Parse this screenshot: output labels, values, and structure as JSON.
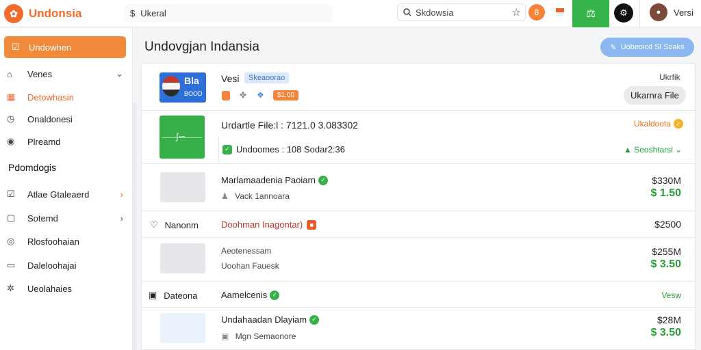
{
  "app": {
    "name": "Undonsia",
    "logo_glyph": "✿"
  },
  "topbar": {
    "search_left": "Ukeral",
    "search_right": "Skdowsia",
    "orange_dot": "8",
    "user_name": "Versi"
  },
  "sidebar": {
    "active_item": "Undowhen",
    "items": [
      {
        "label": "Venes"
      },
      {
        "label": "Detowhasin"
      },
      {
        "label": "Onaldonesi"
      },
      {
        "label": "Plreamd"
      }
    ],
    "section_heading": "Pdomdogis",
    "section_items": [
      {
        "label": "Atlae Gtaleaerd"
      },
      {
        "label": "Sotemd"
      },
      {
        "label": "Rlosfoohaian"
      },
      {
        "label": "Daleloohajai"
      },
      {
        "label": "Ueolahaies"
      }
    ]
  },
  "main": {
    "title": "Undovgjan Indansia",
    "primary_button": "Uobeoicd Sl Soaks"
  },
  "rows": {
    "r1": {
      "flag_title": "Bla",
      "flag_sub": "BOOD",
      "name": "Vesi",
      "tag": "Skeaoorao",
      "orange_chip": "$1,00",
      "right_label": "Ukrfik",
      "file_button": "Ukarnra File"
    },
    "r2": {
      "line1": "Urdartle File:l  : 7121.0 3.083302",
      "line2": "Undoomes : 108 Sodar2:36",
      "status": "Ukaldoota",
      "dropdown": "Seoshtarsi"
    },
    "r3": {
      "title": "Marlamaadenia Paoiarn",
      "sub": "Vack 1annoara",
      "price1": "$330M",
      "price2": "$ 1.50"
    },
    "r4": {
      "label": "Nanonm",
      "link": "Doohman Inagontar)",
      "price": "$2500"
    },
    "r5": {
      "title": "Aeotenessam",
      "sub": "Uoohan  Fauesk",
      "price1": "$255M",
      "price2": "$ 3.50"
    },
    "r6": {
      "label": "Dateona",
      "title": "Aamelcenis",
      "action": "Vesw"
    },
    "r7": {
      "title": "Undahaadan Dlayiam",
      "sub": "Mgn Semaonore",
      "price1": "$28M",
      "price2": "$ 3.50"
    }
  },
  "colors": {
    "accent": "#f26b2c",
    "green": "#36b34a",
    "blue": "#8bb6f0"
  }
}
